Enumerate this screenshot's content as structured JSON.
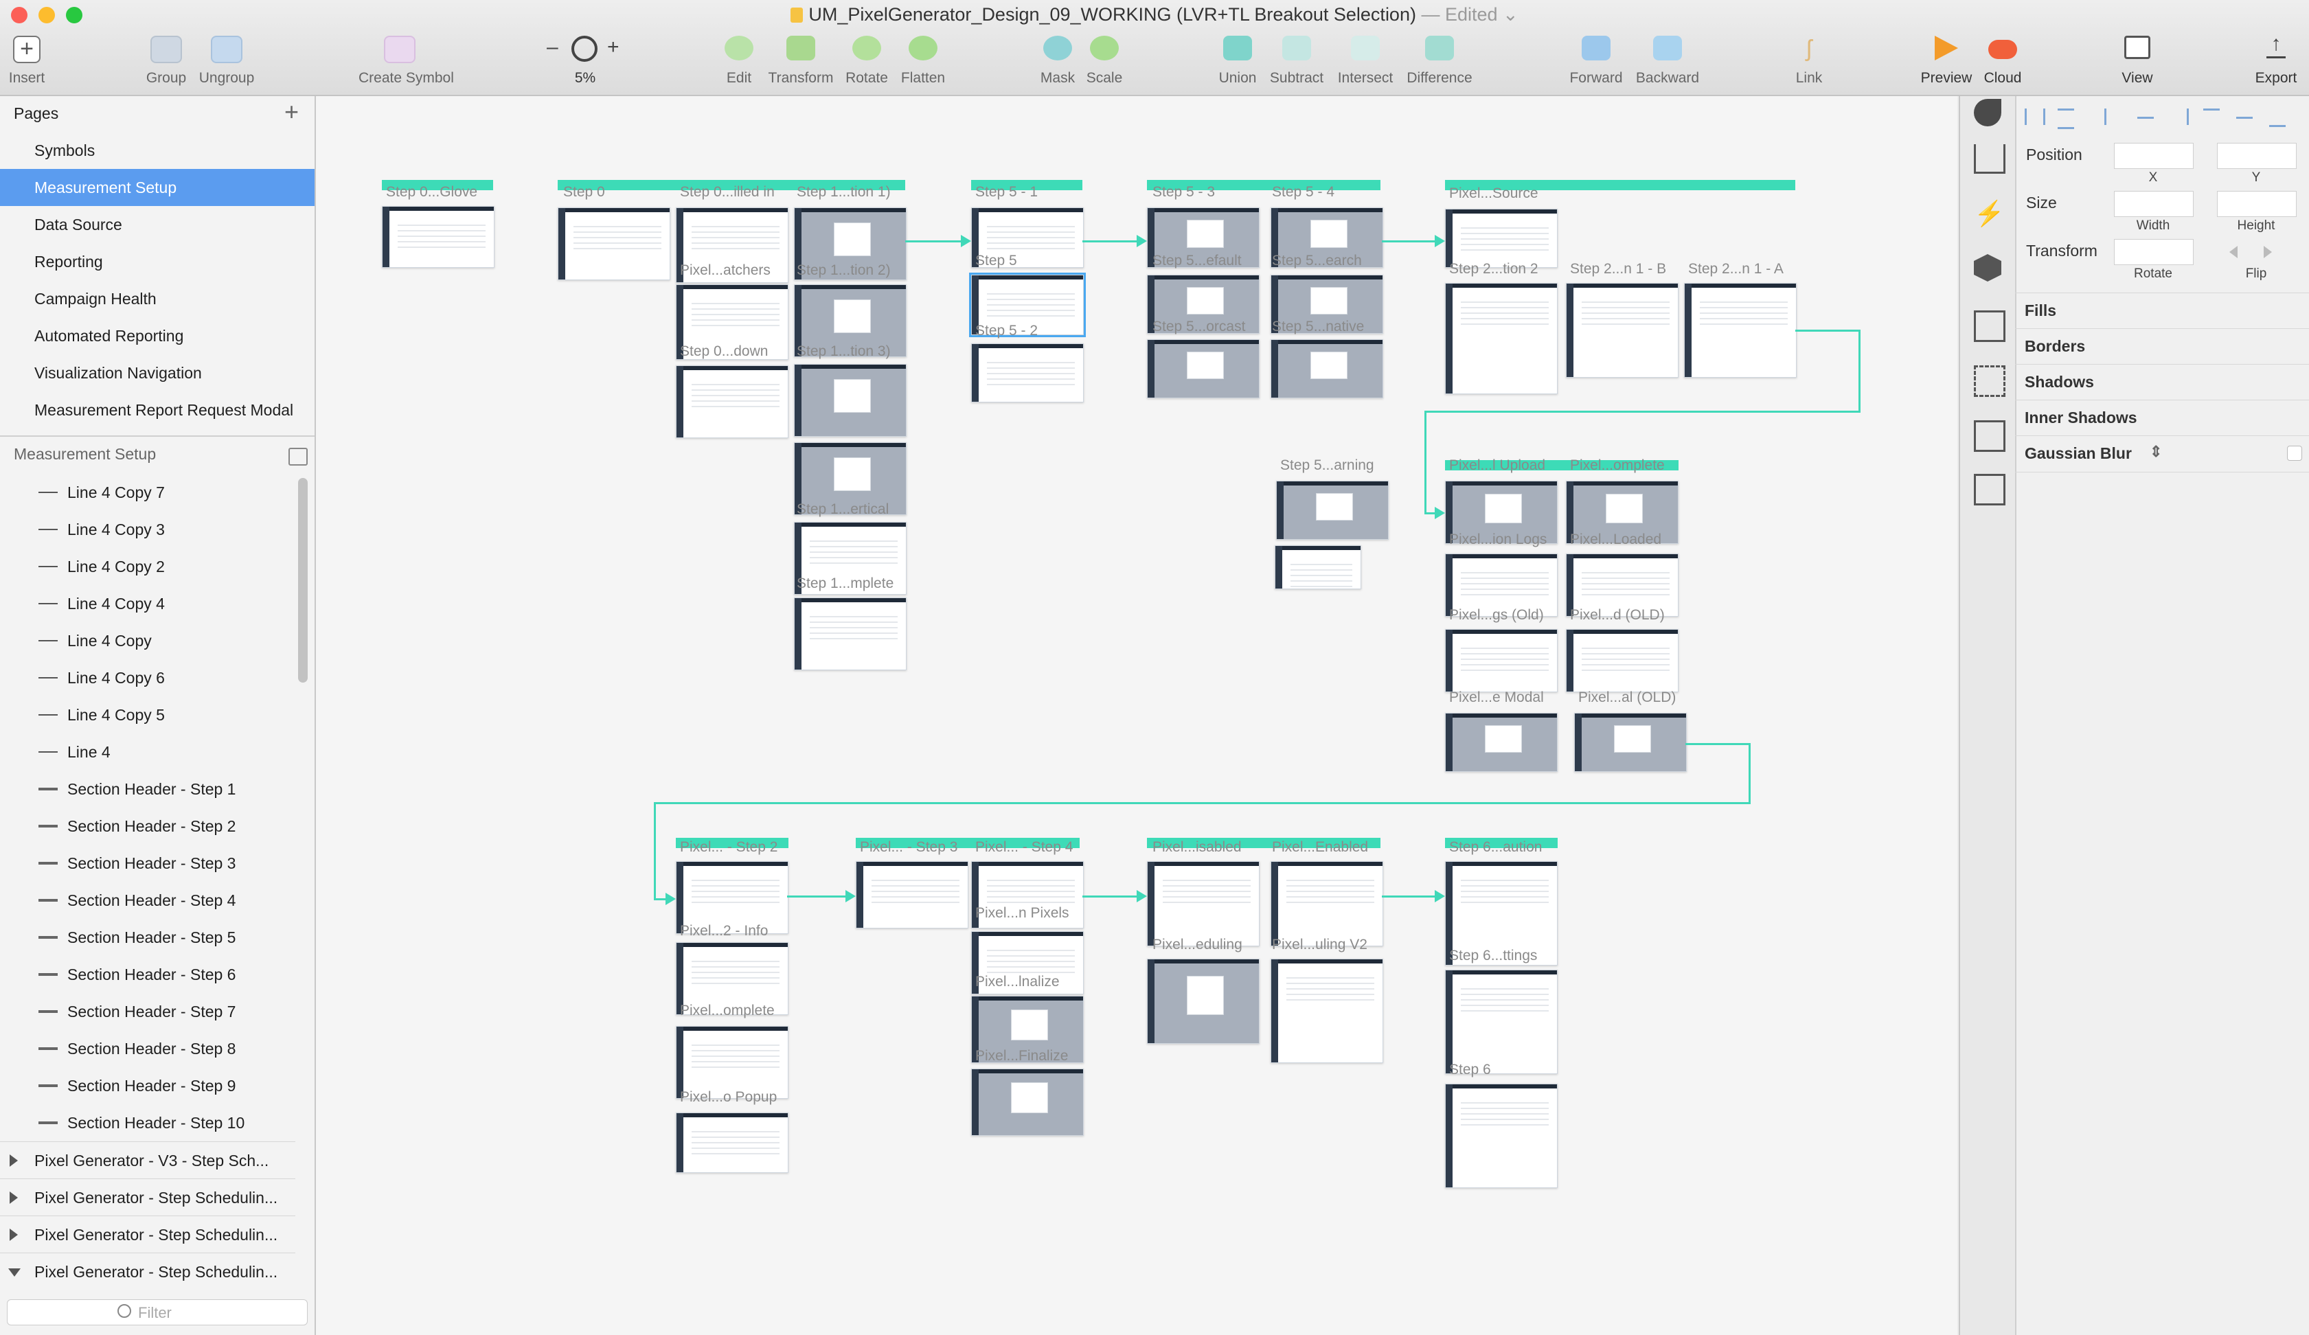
{
  "window": {
    "title": "UM_PixelGenerator_Design_09_WORKING (LVR+TL Breakout Selection)",
    "edited": "— Edited"
  },
  "toolbar": {
    "insert": "Insert",
    "group": "Group",
    "ungroup": "Ungroup",
    "create_symbol": "Create Symbol",
    "zoom_minus": "–",
    "zoom_value": "5%",
    "zoom_plus": "+",
    "edit": "Edit",
    "transform": "Transform",
    "rotate": "Rotate",
    "flatten": "Flatten",
    "mask": "Mask",
    "scale": "Scale",
    "union": "Union",
    "subtract": "Subtract",
    "intersect": "Intersect",
    "difference": "Difference",
    "forward": "Forward",
    "backward": "Backward",
    "link": "Link",
    "preview": "Preview",
    "cloud": "Cloud",
    "view": "View",
    "export": "Export"
  },
  "pages": {
    "header": "Pages",
    "add": "+",
    "items": [
      "Symbols",
      "Measurement Setup",
      "Data Source",
      "Reporting",
      "Campaign Health",
      "Automated Reporting",
      "Visualization Navigation",
      "Measurement Report Request Modal"
    ],
    "selected": "Measurement Setup"
  },
  "layers": {
    "header": "Measurement Setup",
    "items": [
      "Line 4 Copy 7",
      "Line 4 Copy 3",
      "Line 4 Copy 2",
      "Line 4 Copy 4",
      "Line 4 Copy",
      "Line 4 Copy 6",
      "Line 4 Copy 5",
      "Line 4",
      "Section Header - Step 1",
      "Section Header - Step 2",
      "Section Header - Step 3",
      "Section Header - Step 4",
      "Section Header - Step 5",
      "Section Header - Step 6",
      "Section Header - Step 7",
      "Section Header - Step 8",
      "Section Header - Step 9",
      "Section Header - Step 10"
    ],
    "groups": [
      "Pixel Generator - V3 - Step Sch...",
      "Pixel Generator - Step Schedulin...",
      "Pixel Generator - Step Schedulin...",
      "Pixel Generator - Step Schedulin..."
    ],
    "filter_placeholder": "Filter"
  },
  "canvas": {
    "labels": [
      "Step 0...Glove",
      "Step 0",
      "Step 0...illed in",
      "Step 1...tion 1)",
      "Pixel...atchers",
      "Step 1...tion 2)",
      "Step 0...down",
      "Step 1...tion 3)",
      "Step 1...ertical",
      "Step 1...mplete",
      "Step 5 - 1",
      "Step 5",
      "Step 5 - 2",
      "Step 5 - 3",
      "Step 5 - 4",
      "Step 5...efault",
      "Step 5...earch",
      "Step 5...orcast",
      "Step 5...native",
      "Pixel...Source",
      "Step 2...tion 2",
      "Step 2...n 1 - B",
      "Step 2...n 1 - A",
      "Step 5...arning",
      "Pixel...l Upload",
      "Pixel...omplete",
      "Pixel...ion Logs",
      "Pixel...Loaded",
      "Pixel...gs (Old)",
      "Pixel...d (OLD)",
      "Pixel...e Modal",
      "Pixel...al (OLD)",
      "Pixel... - Step 2",
      "Pixel...2 - Info",
      "Pixel...omplete",
      "Pixel...o Popup",
      "Pixel... - Step 3",
      "Pixel... - Step 4",
      "Pixel...n Pixels",
      "Pixel...lnalize",
      "Pixel...Finalize",
      "Pixel...isabled",
      "Pixel...Enabled",
      "Pixel...eduling",
      "Pixel...uling V2",
      "Step 6...aution",
      "Step 6...ttings",
      "Step 6"
    ]
  },
  "inspector": {
    "position": "Position",
    "x": "X",
    "y": "Y",
    "size": "Size",
    "width": "Width",
    "height": "Height",
    "transform": "Transform",
    "rotate": "Rotate",
    "flip": "Flip",
    "fills": "Fills",
    "borders": "Borders",
    "shadows": "Shadows",
    "inner_shadows": "Inner Shadows",
    "gaussian_blur": "Gaussian Blur"
  },
  "colors": {
    "accent": "#5b9cef",
    "connector": "#40d8b8",
    "header_bar": "#3ddbb7"
  }
}
